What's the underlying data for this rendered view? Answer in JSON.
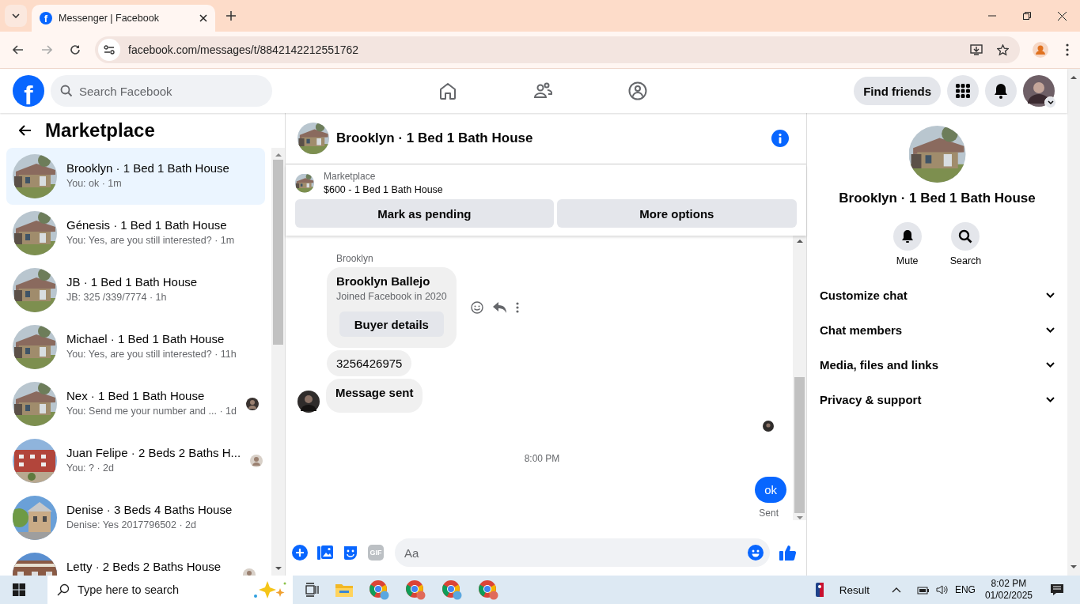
{
  "browser": {
    "favicon": "f",
    "tab_title": "Messenger | Facebook",
    "url": "facebook.com/messages/t/8842142212551762",
    "forward_disabled": true
  },
  "header": {
    "logo": "f",
    "search_placeholder": "Search Facebook",
    "find_friends": "Find friends"
  },
  "sidebar": {
    "title": "Marketplace",
    "conversations": [
      {
        "title": "Brooklyn · 1 Bed 1 Bath House",
        "preview": "You: ok · 1m",
        "selected": true,
        "seen_avatar": false
      },
      {
        "title": "Génesis · 1 Bed 1 Bath House",
        "preview": "You: Yes, are you still interested? · 1m",
        "selected": false,
        "seen_avatar": false
      },
      {
        "title": "JB · 1 Bed 1 Bath House",
        "preview": "JB: 325 /339/7774 · 1h",
        "selected": false,
        "seen_avatar": false
      },
      {
        "title": "Michael · 1 Bed 1 Bath House",
        "preview": "You: Yes, are you still interested? · 11h",
        "selected": false,
        "seen_avatar": false
      },
      {
        "title": "Nex · 1 Bed 1 Bath House",
        "preview": "You: Send me your number and ... · 1d",
        "selected": false,
        "seen_avatar": true
      },
      {
        "title": "Juan Felipe · 2 Beds 2 Baths H...",
        "preview": "You: ? · 2d",
        "selected": false,
        "seen_avatar": true
      },
      {
        "title": "Denise · 3 Beds 4 Baths House",
        "preview": "Denise: Yes 2017796502 · 2d",
        "selected": false,
        "seen_avatar": false
      },
      {
        "title": "Letty · 2 Beds 2 Baths House",
        "selected": false,
        "seen_avatar": true
      }
    ]
  },
  "chat": {
    "title": "Brooklyn · 1 Bed 1 Bath House",
    "listing": {
      "label": "Marketplace",
      "item": "$600 - 1 Bed 1 Bath House"
    },
    "actions": [
      "Mark as pending",
      "More options"
    ],
    "messages": [
      {
        "kind": "sender",
        "text": "Brooklyn"
      },
      {
        "kind": "card",
        "name": "Brooklyn Ballejo",
        "detail": "Joined Facebook in 2020",
        "button": "Buyer details"
      },
      {
        "kind": "text",
        "text": "3256426975"
      },
      {
        "kind": "text_bold",
        "text": "Message sent",
        "avatar": true
      },
      {
        "kind": "seen"
      },
      {
        "kind": "time",
        "text": "8:00 PM"
      },
      {
        "kind": "outgoing",
        "text": "ok",
        "status": "Sent"
      }
    ],
    "composer": {
      "gif": "GIF",
      "placeholder": "Aa"
    }
  },
  "details": {
    "title": "Brooklyn · 1 Bed 1 Bath House",
    "actions": [
      {
        "kind": "mute",
        "label": "Mute"
      },
      {
        "kind": "search",
        "label": "Search"
      }
    ],
    "sections": [
      "Customize chat",
      "Chat members",
      "Media, files and links",
      "Privacy & support"
    ]
  },
  "taskbar": {
    "search_placeholder": "Type here to search",
    "widget": "Result",
    "language": "ENG",
    "time": "8:02 PM",
    "date": "01/02/2025"
  }
}
